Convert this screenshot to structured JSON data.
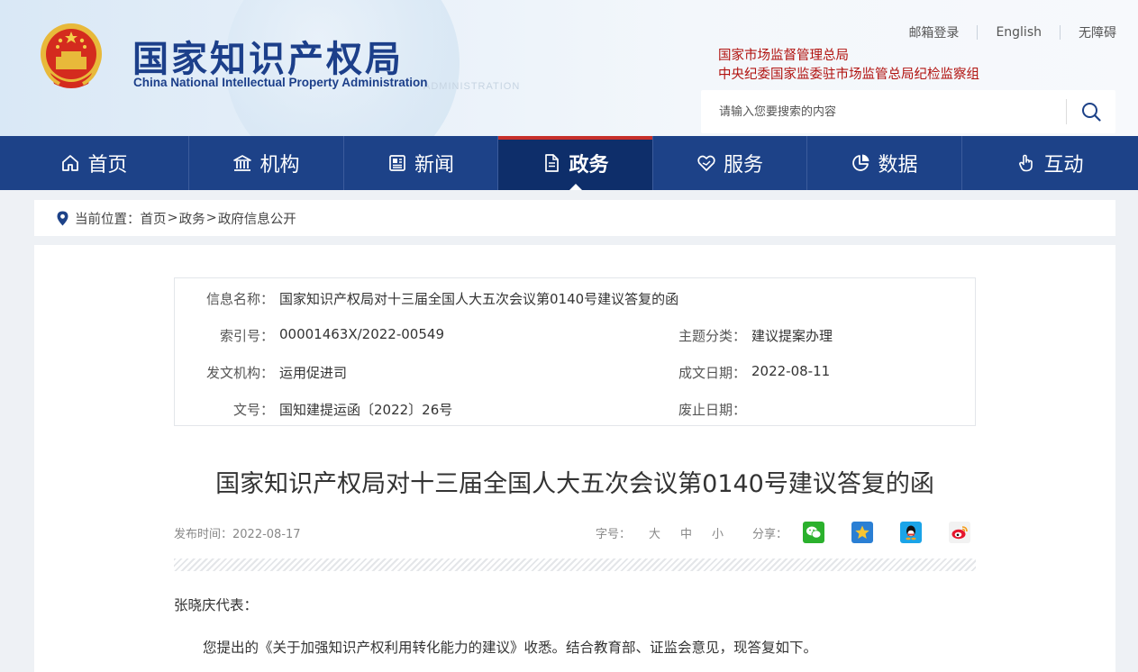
{
  "header": {
    "site_title_cn": "国家知识产权局",
    "site_title_en": "China National Intellectual Property Administration",
    "watermark": "ADMINISTRATION",
    "top_links": [
      "邮箱登录",
      "English",
      "无障碍"
    ],
    "agencies": [
      "国家市场监督管理总局",
      "中央纪委国家监委驻市场监管总局纪检监察组"
    ],
    "search_placeholder": "请输入您要搜索的内容",
    "search_icon": "search-icon"
  },
  "nav": {
    "items": [
      {
        "label": "首页",
        "icon": "home-icon"
      },
      {
        "label": "机构",
        "icon": "institution-icon"
      },
      {
        "label": "新闻",
        "icon": "news-icon"
      },
      {
        "label": "政务",
        "icon": "document-icon",
        "active": true
      },
      {
        "label": "服务",
        "icon": "service-icon"
      },
      {
        "label": "数据",
        "icon": "pie-chart-icon"
      },
      {
        "label": "互动",
        "icon": "hand-pointer-icon"
      }
    ]
  },
  "breadcrumb": {
    "prefix": "当前位置：",
    "items": [
      "首页",
      "政务",
      "政府信息公开"
    ],
    "separator": ">"
  },
  "info": {
    "name_label": "信息名称：",
    "name_value": "国家知识产权局对十三届全国人大五次会议第0140号建议答复的函",
    "index_label": "索引号：",
    "index_value": "00001463X/2022-00549",
    "topic_label": "主题分类：",
    "topic_value": "建议提案办理",
    "issuer_label": "发文机构：",
    "issuer_value": "运用促进司",
    "date_label": "成文日期：",
    "date_value": "2022-08-11",
    "docno_label": "文号：",
    "docno_value": "国知建提运函〔2022〕26号",
    "expire_label": "废止日期：",
    "expire_value": ""
  },
  "article": {
    "title": "国家知识产权局对十三届全国人大五次会议第0140号建议答复的函",
    "publish_label": "发布时间：",
    "publish_date": "2022-08-17",
    "font_size_label": "字号：",
    "font_sizes": [
      "大",
      "中",
      "小"
    ],
    "share_label": "分享：",
    "share_targets": [
      "wechat-icon",
      "qzone-icon",
      "qq-icon",
      "weibo-icon"
    ],
    "salutation": "张晓庆代表：",
    "paragraph_1": "您提出的《关于加强知识产权利用转化能力的建议》收悉。结合教育部、证监会意见，现答复如下。"
  },
  "colors": {
    "nav_bg": "#1d4288",
    "nav_active_bg": "#0e2e6a",
    "accent_red": "#c62f2a",
    "title_blue": "#1c3f8a",
    "agency_red": "#b1120f"
  }
}
